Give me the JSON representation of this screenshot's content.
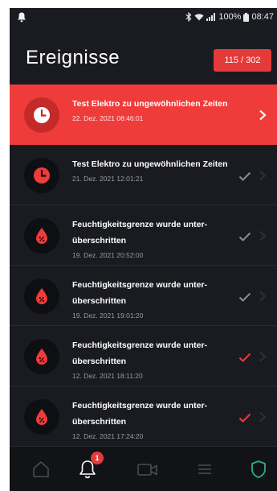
{
  "status_bar": {
    "battery": "100%",
    "time": "08:47"
  },
  "header": {
    "title": "Ereignisse",
    "counter": "115 / 302"
  },
  "events": [
    {
      "message": "Test Elektro zu ungewöhnlichen Zeiten",
      "date": "22. Dez. 2021 08:46:01",
      "icon": "clock-icon",
      "state": "active"
    },
    {
      "message": "Test Elektro zu ungewöhnlichen Zeiten",
      "date": "21. Dez. 2021 12:01:21",
      "icon": "clock-icon",
      "state": "checked-gray"
    },
    {
      "message": "Feuchtigkeitsgrenze wurde unter-überschritten",
      "date": "19. Dez. 2021 20:52:00",
      "icon": "humidity-drop-icon",
      "state": "checked-gray"
    },
    {
      "message": "Feuchtigkeitsgrenze wurde unter-überschritten",
      "date": "19. Dez. 2021 19:01:20",
      "icon": "humidity-drop-icon",
      "state": "checked-gray"
    },
    {
      "message": "Feuchtigkeitsgrenze wurde unter-überschritten",
      "date": "12. Dez. 2021 18:11:20",
      "icon": "humidity-drop-icon",
      "state": "checked-red"
    },
    {
      "message": "Feuchtigkeitsgrenze wurde unter-überschritten",
      "date": "12. Dez. 2021 17:24:20",
      "icon": "humidity-drop-icon",
      "state": "checked-red"
    }
  ],
  "tabs": [
    {
      "icon": "home-icon"
    },
    {
      "icon": "bell-icon",
      "count": "1",
      "active": true
    },
    {
      "icon": "video-camera-icon"
    },
    {
      "icon": "menu-icon"
    },
    {
      "icon": "shield-icon"
    }
  ],
  "colors": {
    "accent": "#f03b3b",
    "background": "#1a1b20",
    "tabbar": "#121317",
    "shield": "#2db07a",
    "check_gray": "#8c8d92"
  }
}
